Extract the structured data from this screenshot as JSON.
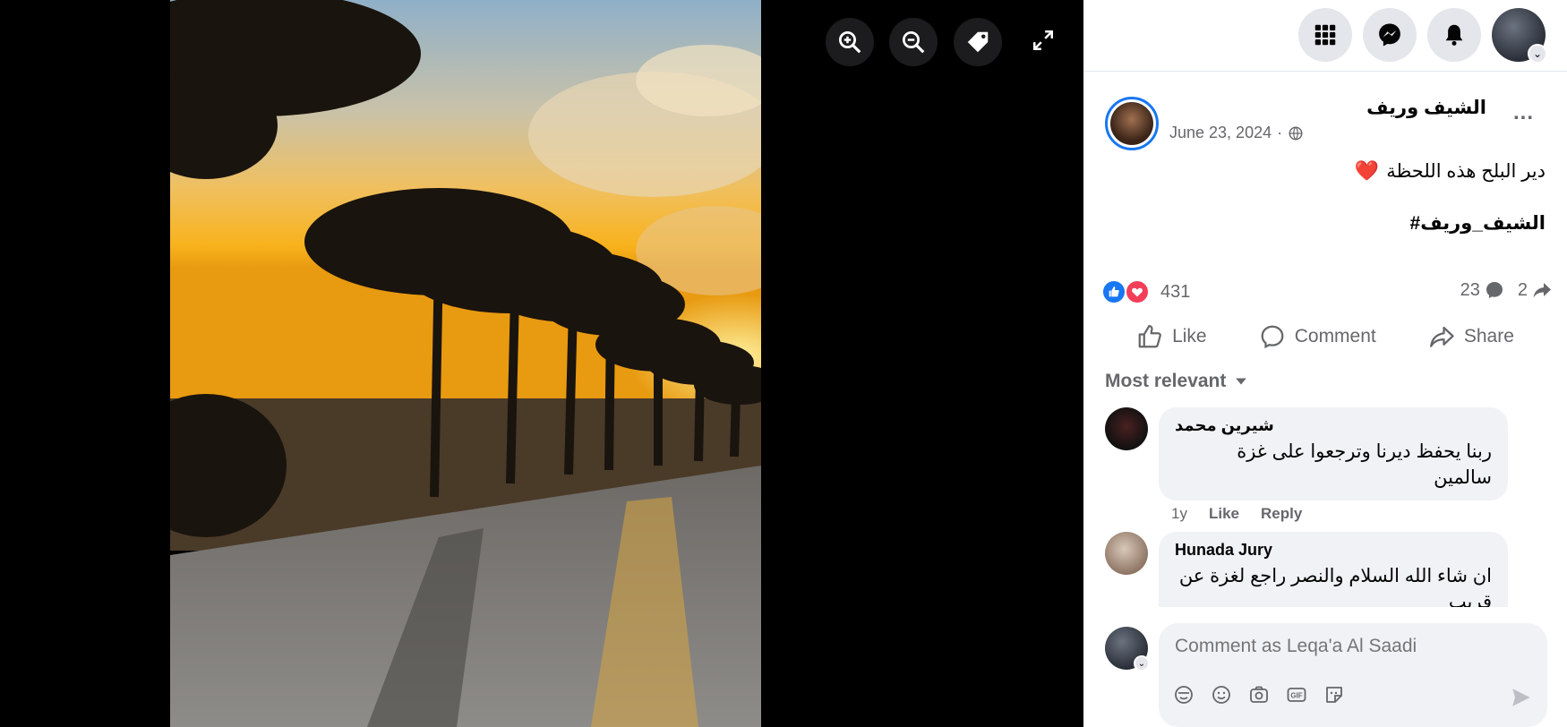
{
  "viewer": {
    "zoom_in_label": "zoom in",
    "zoom_out_label": "zoom out",
    "tag_label": "tag",
    "fullscreen_label": "fullscreen"
  },
  "post": {
    "author": "الشيف وريف",
    "date": "June 23, 2024",
    "separator": "·",
    "text_line": "دير البلح هذه اللحظة",
    "heart": "❤️",
    "hashtag": "#الشيف_وريف",
    "reaction_count": "431",
    "comment_count": "23",
    "share_count": "2",
    "more": "..."
  },
  "actions": {
    "like": "Like",
    "comment": "Comment",
    "share": "Share"
  },
  "sort_label": "Most relevant",
  "comments": [
    {
      "name": "شيرين محمد",
      "text": "ربنا يحفظ ديرنا وترجعوا على غزة سالمين",
      "time": "1y",
      "like": "Like",
      "reply": "Reply"
    },
    {
      "name": "Hunada Jury",
      "text": "ان شاء الله السلام والنصر راجع لغزة عن قريب"
    }
  ],
  "composer": {
    "placeholder": "Comment as Leqa'a Al Saadi"
  },
  "colors": {
    "accent": "#1877f2",
    "love": "#f33e58"
  }
}
